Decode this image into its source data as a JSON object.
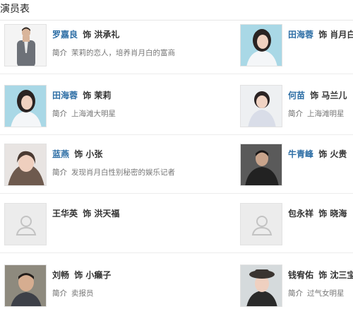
{
  "header": {
    "title": "演员表"
  },
  "labels": {
    "as": "饰",
    "intro": "简介"
  },
  "cast": [
    {
      "actor": "罗嘉良",
      "role": "洪承礼",
      "intro": "茉莉的恋人，培养肖月白的富商",
      "photo": "man-suit-photo",
      "linked": true
    },
    {
      "actor": "田海蓉",
      "role": "肖月白",
      "intro": "",
      "photo": "woman-white-shirt-photo",
      "linked": true
    },
    {
      "actor": "田海蓉",
      "role": "茉莉",
      "intro": "上海滩大明星",
      "photo": "woman-white-shirt-photo",
      "linked": true
    },
    {
      "actor": "何苗",
      "role": "马兰儿",
      "intro": "上海滩明星",
      "photo": "woman-short-hair-photo",
      "linked": true
    },
    {
      "actor": "蓝燕",
      "role": "小张",
      "intro": "发现肖月白性别秘密的娱乐记者",
      "photo": "woman-smiling-photo",
      "linked": true
    },
    {
      "actor": "牛青峰",
      "role": "火贵",
      "intro": "",
      "photo": "man-dark-coat-photo",
      "linked": true
    },
    {
      "actor": "王华英",
      "role": "洪天福",
      "intro": "",
      "photo": "placeholder-avatar-icon",
      "linked": false
    },
    {
      "actor": "包永祥",
      "role": "晓海",
      "intro": "",
      "photo": "placeholder-avatar-icon",
      "linked": false
    },
    {
      "actor": "刘畅",
      "role": "小癞子",
      "intro": "卖报员",
      "photo": "man-smiling-photo",
      "linked": false
    },
    {
      "actor": "钱宥佑",
      "role": "沈三宝",
      "intro": "过气女明星",
      "photo": "woman-hat-photo",
      "linked": false
    }
  ]
}
